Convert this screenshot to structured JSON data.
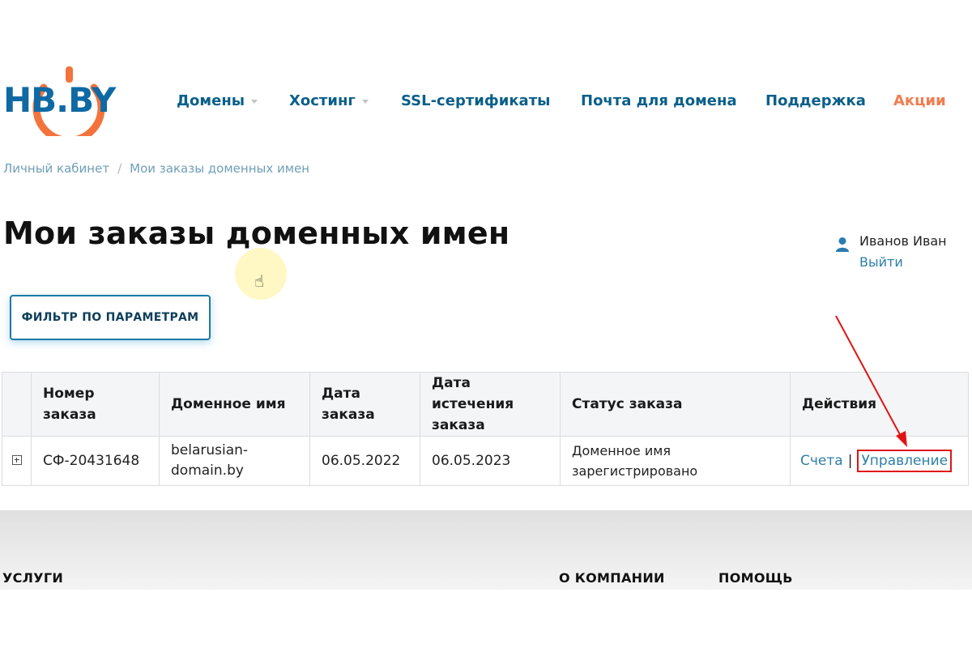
{
  "logo": {
    "text": "HB.BY",
    "colors": {
      "primary": "#0f6aa4",
      "accent": "#f4733c"
    }
  },
  "nav": {
    "items": [
      {
        "label": "Домены",
        "dropdown": true
      },
      {
        "label": "Хостинг",
        "dropdown": true
      },
      {
        "label": "SSL-сертификаты",
        "dropdown": false
      },
      {
        "label": "Почта для домена",
        "dropdown": false
      },
      {
        "label": "Поддержка",
        "dropdown": false
      },
      {
        "label": "Акции",
        "dropdown": false,
        "highlight": "#ef7d4f"
      }
    ]
  },
  "breadcrumb": {
    "items": [
      "Личный кабинет",
      "Мои заказы доменных имен"
    ],
    "separator": "/"
  },
  "page": {
    "title": "Мои заказы доменных имен"
  },
  "user": {
    "name": "Иванов Иван",
    "logout_label": "Выйти",
    "icon": "user-icon"
  },
  "filter": {
    "label": "ФИЛЬТР ПО ПАРАМЕТРАМ"
  },
  "table": {
    "headers": {
      "order_number": "Номер заказа",
      "domain": "Доменное имя",
      "order_date": "Дата заказа",
      "expiry_date": "Дата истечения заказа",
      "status": "Статус заказа",
      "actions": "Действия"
    },
    "rows": [
      {
        "order_number": "СФ-20431648",
        "domain": "belarusian-domain.by",
        "order_date": "06.05.2022",
        "expiry_date": "06.05.2023",
        "status": "Доменное имя зарегистрировано",
        "actions": {
          "invoices": "Счета",
          "separator": "|",
          "manage": "Управление"
        }
      }
    ]
  },
  "footer": {
    "columns": [
      "УСЛУГИ",
      "О КОМПАНИИ",
      "ПОМОЩЬ"
    ]
  },
  "colors": {
    "nav_text": "#0a5f8a",
    "link": "#2e7fa8",
    "annotation_red": "#e01414"
  }
}
